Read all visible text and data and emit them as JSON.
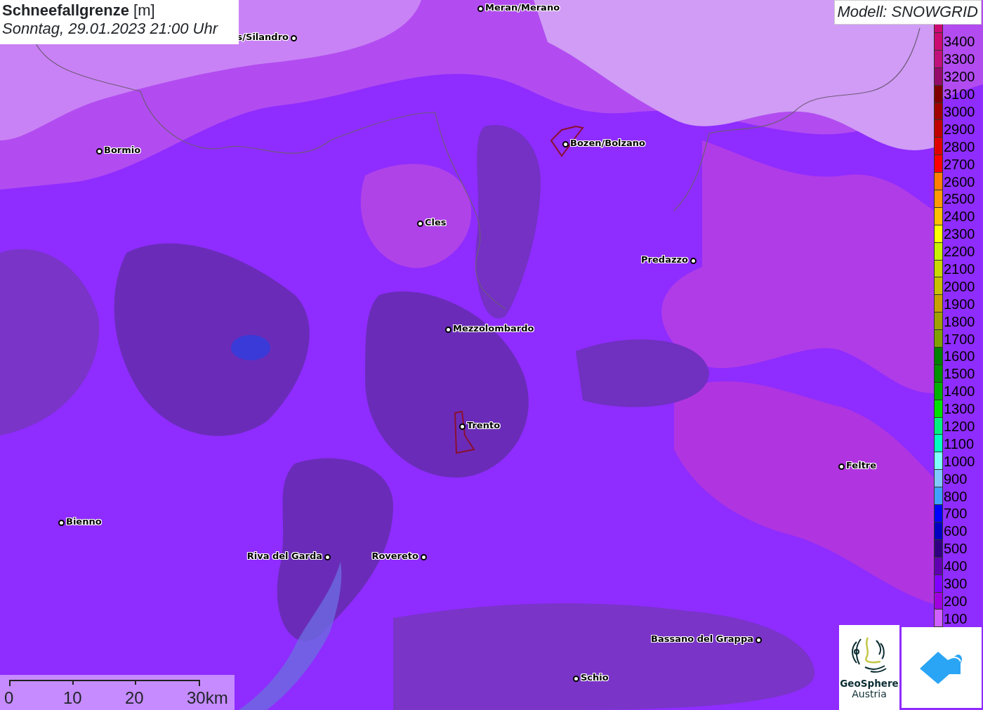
{
  "title": {
    "heading": "**Schneefallgrenze** [m]",
    "time": "Sonntag, 29.01.2023 21:00 Uhr"
  },
  "model": "Modell: SNOWGRID",
  "cities": [
    {
      "name": "Meran/Merano"
    },
    {
      "name": "s/Silandro"
    },
    {
      "name": "Bormio"
    },
    {
      "name": "Bozen/Bolzano"
    },
    {
      "name": "Cles"
    },
    {
      "name": "Predazzo"
    },
    {
      "name": "Mezzolombardo"
    },
    {
      "name": "Trento"
    },
    {
      "name": "Feltre"
    },
    {
      "name": "Bienno"
    },
    {
      "name": "Riva del Garda"
    },
    {
      "name": "Rovereto"
    },
    {
      "name": "Bassano del Grappa"
    },
    {
      "name": "Schio"
    }
  ],
  "legend": [
    {
      "label": "3400",
      "color": "#cc0a72"
    },
    {
      "label": "3300",
      "color": "#c0107a"
    },
    {
      "label": "3200",
      "color": "#960a6a"
    },
    {
      "label": "3100",
      "color": "#800000"
    },
    {
      "label": "3000",
      "color": "#a00000"
    },
    {
      "label": "2900",
      "color": "#c00000"
    },
    {
      "label": "2800",
      "color": "#e00000"
    },
    {
      "label": "2700",
      "color": "#ff0000"
    },
    {
      "label": "2600",
      "color": "#ff8000"
    },
    {
      "label": "2500",
      "color": "#ff9a00"
    },
    {
      "label": "2400",
      "color": "#ffc000"
    },
    {
      "label": "2300",
      "color": "#ffff00"
    },
    {
      "label": "2200",
      "color": "#c8f000"
    },
    {
      "label": "2100",
      "color": "#c8d800"
    },
    {
      "label": "2000",
      "color": "#c8c000"
    },
    {
      "label": "1900",
      "color": "#c8a000"
    },
    {
      "label": "1800",
      "color": "#a0a000"
    },
    {
      "label": "1700",
      "color": "#80a000"
    },
    {
      "label": "1600",
      "color": "#008000"
    },
    {
      "label": "1500",
      "color": "#009000"
    },
    {
      "label": "1400",
      "color": "#00b000"
    },
    {
      "label": "1300",
      "color": "#00e000"
    },
    {
      "label": "1200",
      "color": "#00f080"
    },
    {
      "label": "1100",
      "color": "#00ffc0"
    },
    {
      "label": "1000",
      "color": "#80ffff"
    },
    {
      "label": "900",
      "color": "#80c8ff"
    },
    {
      "label": "800",
      "color": "#40a0ff"
    },
    {
      "label": "700",
      "color": "#0000ff"
    },
    {
      "label": "600",
      "color": "#0000c0"
    },
    {
      "label": "500",
      "color": "#300080"
    },
    {
      "label": "400",
      "color": "#6000b0"
    },
    {
      "label": "300",
      "color": "#8000ff"
    },
    {
      "label": "200",
      "color": "#a000e0"
    },
    {
      "label": "100",
      "color": "#d060ff"
    }
  ],
  "scale": [
    "0",
    "10",
    "20",
    "30km"
  ],
  "logo": {
    "name": "GeoSphere",
    "sub": "Austria"
  }
}
